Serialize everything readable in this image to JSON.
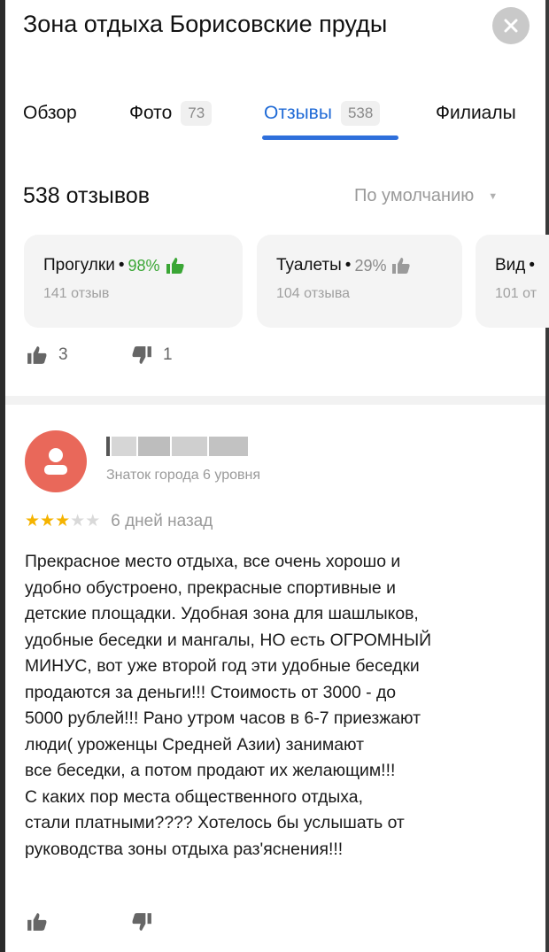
{
  "header": {
    "title": "Зона отдыха Борисовские пруды",
    "close_icon": "close-icon"
  },
  "tabs": [
    {
      "label": "Обзор",
      "count": ""
    },
    {
      "label": "Фото",
      "count": "73"
    },
    {
      "label": "Отзывы",
      "count": "538",
      "active": true
    },
    {
      "label": "Филиалы",
      "count": ""
    }
  ],
  "reviews_header": {
    "count_text": "538 отзывов",
    "sort_label": "По умолчанию"
  },
  "aspects": [
    {
      "name": "Прогулки",
      "percent": "98%",
      "reviews": "141 отзыв",
      "color": "#3aa635"
    },
    {
      "name": "Туалеты",
      "percent": "29%",
      "reviews": "104 отзыва",
      "color": "#9a9a9a"
    },
    {
      "name": "Вид",
      "percent": "",
      "reviews": "101 от",
      "color": "#9a9a9a"
    }
  ],
  "prev_review_votes": {
    "likes": "3",
    "dislikes": "1"
  },
  "review": {
    "author_level": "Знаток города 6 уровня",
    "rating": 3,
    "rating_max": 5,
    "date": "6 дней назад",
    "text_lines": [
      "Прекрасное место отдыха, все очень хорошо и",
      "удобно  обустроено, прекрасные спортивные и",
      "детские площадки. Удобная зона для шашлыков,",
      "удобные беседки и мангалы, НО есть ОГРОМНЫЙ",
      "МИНУС,  вот уже второй год эти удобные беседки",
      "продаются за деньги!!!  Стоимость от 3000 - до",
      "5000 рублей!!! Рано утром часов в 6-7 приезжают",
      "люди( уроженцы Средней Азии) занимают",
      "все беседки, а потом продают их желающим!!!",
      "С каких пор места общественного отдыха,",
      "стали платными???? Хотелось бы услышать от",
      "руководства зоны отдыха раз'яснения!!!"
    ]
  },
  "colors": {
    "accent_blue": "#2e6fdb",
    "avatar_red": "#e9685a",
    "star_gold": "#f5b300",
    "positive_green": "#3aa635"
  }
}
